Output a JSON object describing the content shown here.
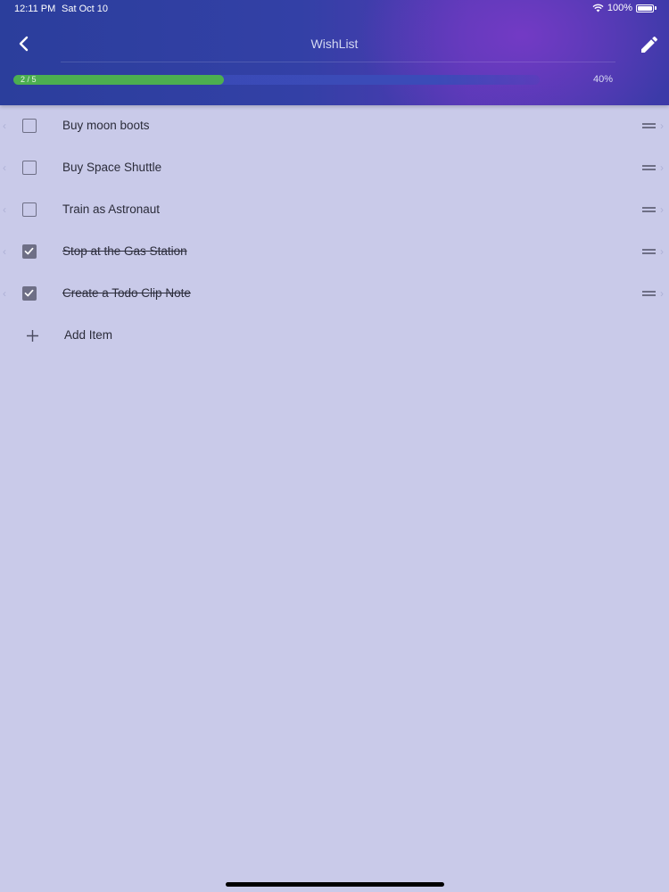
{
  "status_bar": {
    "time": "12:11 PM",
    "date": "Sat Oct 10",
    "battery": "100%"
  },
  "header": {
    "title": "WishList",
    "back_icon": "chevron-left-icon",
    "edit_icon": "pencil-icon"
  },
  "progress": {
    "count": "2 / 5",
    "percent_label": "40%",
    "fraction": 0.4
  },
  "items": [
    {
      "label": "Buy moon boots",
      "checked": false
    },
    {
      "label": "Buy Space Shuttle",
      "checked": false
    },
    {
      "label": "Train as Astronaut",
      "checked": false
    },
    {
      "label": "Stop at the Gas Station",
      "checked": true
    },
    {
      "label": "Create a Todo Clip Note",
      "checked": true
    }
  ],
  "add_item": {
    "label": "Add Item"
  },
  "colors": {
    "header_start": "#2b3e9c",
    "header_accent": "#7a3ac8",
    "progress": "#4caf50",
    "background": "#c9cae9"
  }
}
